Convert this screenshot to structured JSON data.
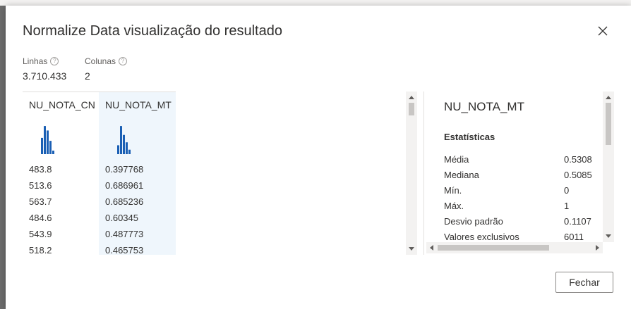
{
  "modal": {
    "title": "Normalize Data visualização do resultado",
    "close_icon": "close-icon"
  },
  "meta": {
    "rows_label": "Linhas",
    "rows_value": "3.710.433",
    "cols_label": "Colunas",
    "cols_value": "2",
    "info_icon": "info-icon"
  },
  "grid": {
    "columns": [
      {
        "header": "NU_NOTA_CN",
        "selected": false,
        "histogram": [
          0.55,
          0.95,
          0.8,
          0.45,
          0.12
        ],
        "cells": [
          "483.8",
          "513.6",
          "563.7",
          "484.6",
          "543.9",
          "518.2"
        ]
      },
      {
        "header": "NU_NOTA_MT",
        "selected": true,
        "histogram": [
          0.3,
          0.95,
          0.65,
          0.4,
          0.15
        ],
        "cells": [
          "0.397768",
          "0.686961",
          "0.685236",
          "0.60345",
          "0.487773",
          "0.465753"
        ]
      }
    ]
  },
  "stats": {
    "title": "NU_NOTA_MT",
    "heading": "Estatísticas",
    "items": [
      {
        "label": "Média",
        "value": "0.5308"
      },
      {
        "label": "Mediana",
        "value": "0.5085"
      },
      {
        "label": "Mín.",
        "value": "0"
      },
      {
        "label": "Máx.",
        "value": "1"
      },
      {
        "label": "Desvio padrão",
        "value": "0.1107"
      },
      {
        "label": "Valores exclusivos",
        "value": "6011"
      }
    ]
  },
  "footer": {
    "close_button": "Fechar"
  },
  "colors": {
    "bar": "#1a5fb4",
    "selected_column_bg": "#eff6fc"
  }
}
